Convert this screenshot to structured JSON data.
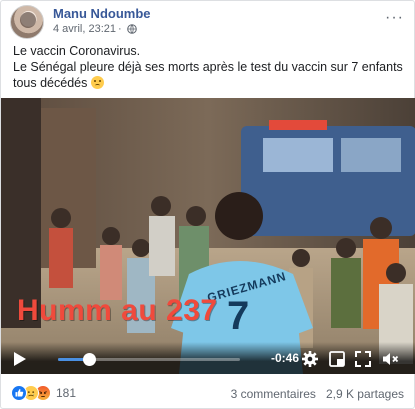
{
  "post": {
    "author": "Manu Ndoumbe",
    "timestamp": "4 avril, 23:21",
    "privacy_icon": "globe-icon",
    "text_line1": "Le vaccin Coronavirus.",
    "text_line2": "Le Sénégal pleure déjà ses morts après le test du vaccin sur 7 enfants tous décédés"
  },
  "video": {
    "overlay_caption": "Humm au 237",
    "jersey_name": "GRIEZMANN",
    "jersey_number": "7",
    "time_remaining": "-0:46",
    "progress": 0.17,
    "icons": [
      "play-icon",
      "settings-gear-icon",
      "picture-in-picture-icon",
      "fullscreen-icon",
      "volume-muted-icon"
    ],
    "accent_color": "#4a90e2",
    "caption_color": "#f04a3c"
  },
  "footer": {
    "reaction_icons": [
      "like-icon",
      "sad-icon",
      "angry-icon"
    ],
    "reaction_count": "181",
    "comments": "3 commentaires",
    "shares": "2,9 K partages"
  }
}
